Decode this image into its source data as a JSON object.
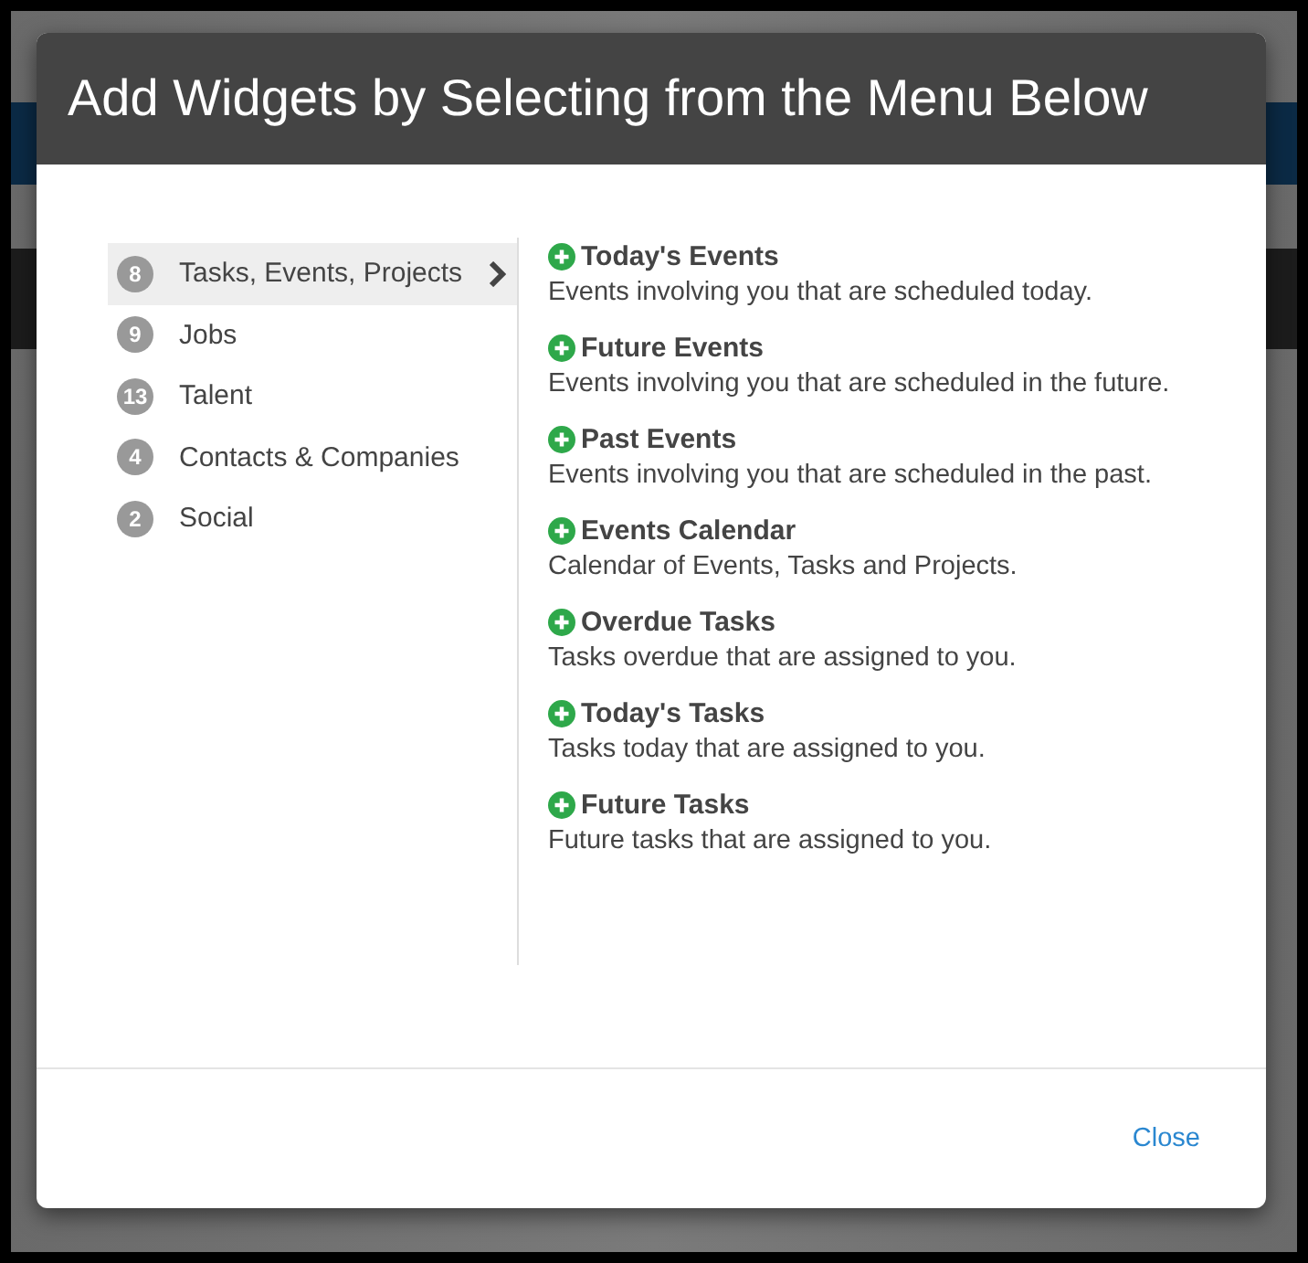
{
  "dialog": {
    "title": "Add Widgets by Selecting from the Menu Below"
  },
  "categories": [
    {
      "count": "8",
      "label": "Tasks, Events, Projects",
      "selected": true
    },
    {
      "count": "9",
      "label": "Jobs",
      "selected": false
    },
    {
      "count": "13",
      "label": "Talent",
      "selected": false
    },
    {
      "count": "4",
      "label": "Contacts & Companies",
      "selected": false
    },
    {
      "count": "2",
      "label": "Social",
      "selected": false
    }
  ],
  "widgets": [
    {
      "name": "Today's Events",
      "description": "Events involving you that are scheduled today."
    },
    {
      "name": "Future Events",
      "description": "Events involving you that are scheduled in the future."
    },
    {
      "name": "Past Events",
      "description": "Events involving you that are scheduled in the past."
    },
    {
      "name": "Events Calendar",
      "description": "Calendar of Events, Tasks and Projects."
    },
    {
      "name": "Overdue Tasks",
      "description": "Tasks overdue that are assigned to you."
    },
    {
      "name": "Today's Tasks",
      "description": "Tasks today that are assigned to you."
    },
    {
      "name": "Future Tasks",
      "description": "Future tasks that are assigned to you."
    }
  ],
  "footer": {
    "close_label": "Close"
  }
}
